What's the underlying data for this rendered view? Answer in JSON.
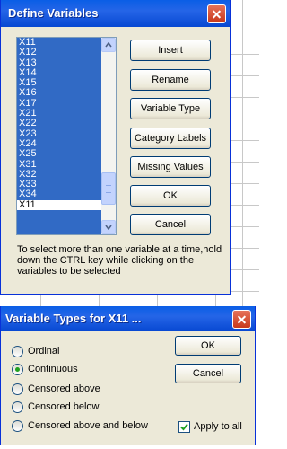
{
  "define_variables": {
    "title": "Define Variables",
    "variables": [
      "X11",
      "X12",
      "X13",
      "X14",
      "X15",
      "X16",
      "X17",
      "X21",
      "X22",
      "X23",
      "X24",
      "X25",
      "X31",
      "X32",
      "X33",
      "X34",
      "X11"
    ],
    "buttons": {
      "insert": "Insert",
      "rename": "Rename",
      "variable_type": "Variable Type",
      "category_labels": "Category Labels",
      "missing_values": "Missing Values",
      "ok": "OK",
      "cancel": "Cancel"
    },
    "hint": "To select more than one variable at a time,hold down the CTRL key while clicking on the variables to be selected"
  },
  "variable_types": {
    "title": "Variable Types for X11 ...",
    "options": [
      {
        "label": "Ordinal",
        "selected": false
      },
      {
        "label": "Continuous",
        "selected": true
      },
      {
        "label": "Censored above",
        "selected": false
      },
      {
        "label": "Censored below",
        "selected": false
      },
      {
        "label": "Censored above and below",
        "selected": false
      }
    ],
    "buttons": {
      "ok": "OK",
      "cancel": "Cancel"
    },
    "apply_to_all": {
      "label": "Apply to all",
      "checked": true
    }
  },
  "colors": {
    "title_bar": "#0a5ee6",
    "selection": "#316ac5",
    "close_button": "#d65a3d",
    "window_face": "#ece9d8"
  }
}
